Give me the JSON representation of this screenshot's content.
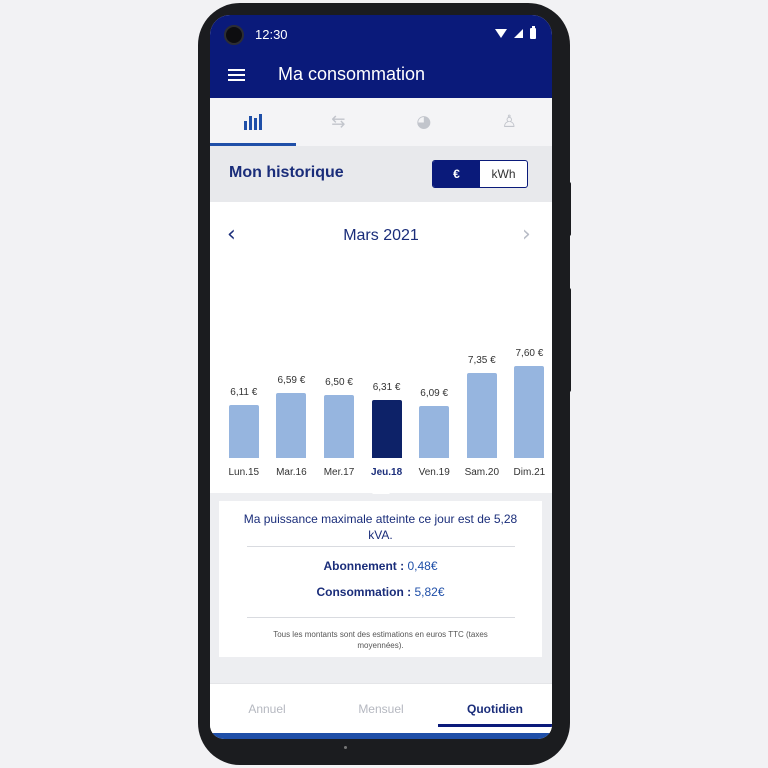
{
  "status_bar": {
    "time": "12:30"
  },
  "app_bar": {
    "title": "Ma consommation",
    "menu_icon": "hamburger-menu-icon"
  },
  "top_tabs": [
    {
      "icon": "bar-chart-icon",
      "active": true
    },
    {
      "icon": "compare-arrows-icon",
      "active": false
    },
    {
      "icon": "pie-chart-icon",
      "active": false
    },
    {
      "icon": "person-icon",
      "active": false
    }
  ],
  "history": {
    "title": "Mon historique",
    "unit_euro": "€",
    "unit_kwh": "kWh",
    "selected_unit": "€"
  },
  "month_nav": {
    "label": "Mars 2021",
    "prev_icon": "chevron-left-icon",
    "next_icon": "chevron-right-icon"
  },
  "colors": {
    "primary": "#0a1a7a",
    "accent": "#1f4fa8",
    "bar": "#96b5df",
    "bar_selected": "#0d2268"
  },
  "chart_data": {
    "type": "bar",
    "categories": [
      "Lun.15",
      "Mar.16",
      "Mer.17",
      "Jeu.18",
      "Ven.19",
      "Sam.20",
      "Dim.21"
    ],
    "values": [
      6.11,
      6.59,
      6.5,
      6.31,
      6.09,
      7.35,
      7.6
    ],
    "value_labels": [
      "6,11 €",
      "6,59 €",
      "6,50 €",
      "6,31 €",
      "6,09 €",
      "7,35 €",
      "7,60 €"
    ],
    "selected_index": 3,
    "title": "",
    "xlabel": "",
    "ylabel": "",
    "ylim": [
      0,
      7.6
    ],
    "grid": false
  },
  "detail": {
    "pmax_text": "Ma puissance maximale atteinte ce jour est de 5,28 kVA.",
    "abonnement_label": "Abonnement :",
    "abonnement_value": "0,48€",
    "consommation_label": "Consommation :",
    "consommation_value": "5,82€",
    "note": "Tous les montants sont des estimations en euros TTC (taxes moyennées)."
  },
  "bottom_tabs": [
    {
      "label": "Annuel",
      "active": false
    },
    {
      "label": "Mensuel",
      "active": false
    },
    {
      "label": "Quotidien",
      "active": true
    }
  ]
}
